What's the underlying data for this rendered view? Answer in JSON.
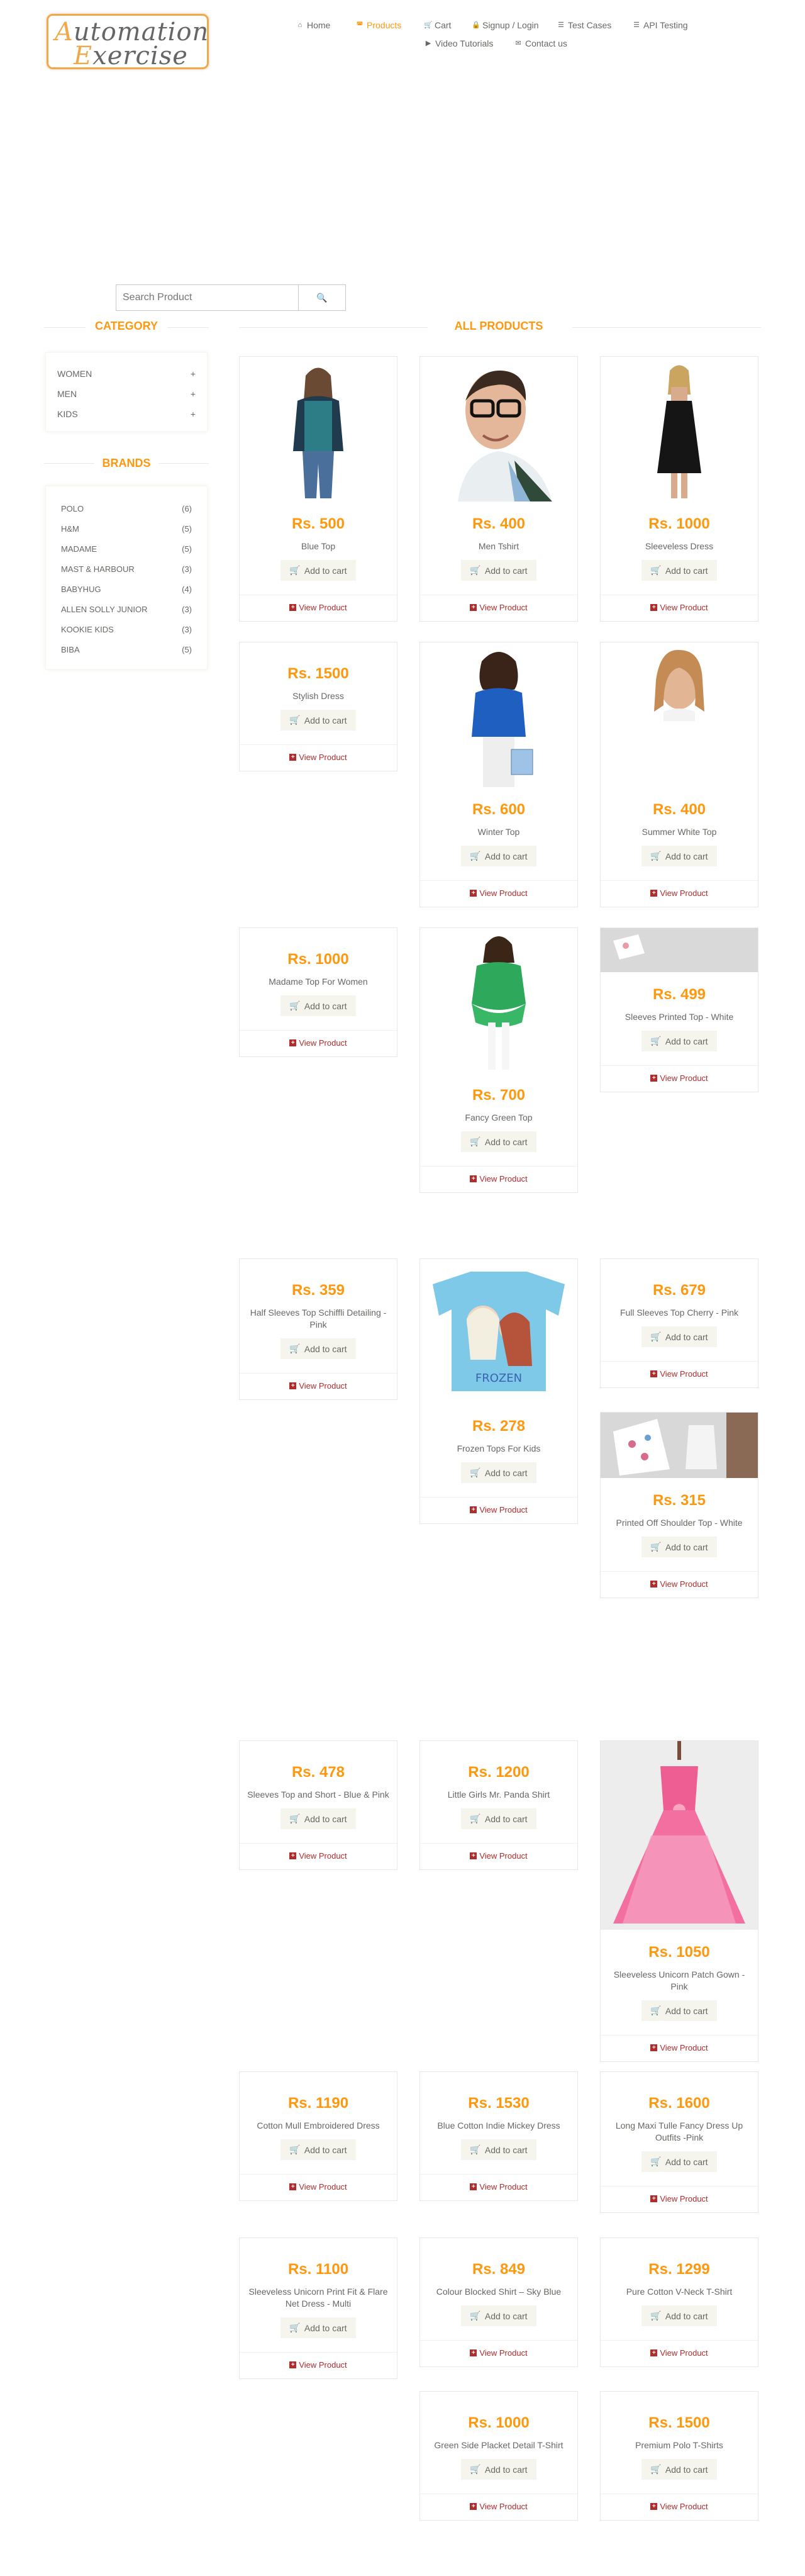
{
  "header": {
    "logo": {
      "line1": "Automation",
      "line2": "Exercise"
    },
    "nav": [
      {
        "label": "Home",
        "icon": "home-icon"
      },
      {
        "label": "Products",
        "icon": "products-icon"
      },
      {
        "label": "Cart",
        "icon": "cart-icon"
      },
      {
        "label": "Signup / Login",
        "icon": "lock-icon"
      },
      {
        "label": "Test Cases",
        "icon": "list-icon"
      },
      {
        "label": "API Testing",
        "icon": "list-icon"
      },
      {
        "label": "Video Tutorials",
        "icon": "youtube-icon"
      },
      {
        "label": "Contact us",
        "icon": "envelope-icon"
      }
    ]
  },
  "search": {
    "placeholder": "Search Product",
    "button_icon": "search-icon"
  },
  "sidebar": {
    "category_title": "Category",
    "categories": [
      {
        "label": "WOMEN"
      },
      {
        "label": "MEN"
      },
      {
        "label": "KIDS"
      }
    ],
    "brands_title": "Brands",
    "brands": [
      {
        "label": "POLO",
        "count": "(6)"
      },
      {
        "label": "H&M",
        "count": "(5)"
      },
      {
        "label": "MADAME",
        "count": "(5)"
      },
      {
        "label": "MAST & HARBOUR",
        "count": "(3)"
      },
      {
        "label": "BABYHUG",
        "count": "(4)"
      },
      {
        "label": "ALLEN SOLLY JUNIOR",
        "count": "(3)"
      },
      {
        "label": "KOOKIE KIDS",
        "count": "(3)"
      },
      {
        "label": "BIBA",
        "count": "(5)"
      }
    ]
  },
  "main": {
    "title": "All Products",
    "add_to_cart": "Add to cart",
    "view_product": "View Product",
    "products": [
      {
        "price": "Rs. 500",
        "name": "Blue Top"
      },
      {
        "price": "Rs. 400",
        "name": "Men Tshirt"
      },
      {
        "price": "Rs. 1000",
        "name": "Sleeveless Dress"
      },
      {
        "price": "Rs. 1500",
        "name": "Stylish Dress"
      },
      {
        "price": "Rs. 600",
        "name": "Winter Top"
      },
      {
        "price": "Rs. 400",
        "name": "Summer White Top"
      },
      {
        "price": "Rs. 1000",
        "name": "Madame Top For Women"
      },
      {
        "price": "Rs. 700",
        "name": "Fancy Green Top"
      },
      {
        "price": "Rs. 499",
        "name": "Sleeves Printed Top - White"
      },
      {
        "price": "Rs. 359",
        "name": "Half Sleeves Top Schiffli Detailing - Pink"
      },
      {
        "price": "Rs. 278",
        "name": "Frozen Tops For Kids"
      },
      {
        "price": "Rs. 679",
        "name": "Full Sleeves Top Cherry - Pink"
      },
      {
        "price": "Rs. 315",
        "name": "Printed Off Shoulder Top - White"
      },
      {
        "price": "Rs. 478",
        "name": "Sleeves Top and Short - Blue & Pink"
      },
      {
        "price": "Rs. 1200",
        "name": "Little Girls Mr. Panda Shirt"
      },
      {
        "price": "Rs. 1050",
        "name": "Sleeveless Unicorn Patch Gown - Pink"
      },
      {
        "price": "Rs. 1190",
        "name": "Cotton Mull Embroidered Dress"
      },
      {
        "price": "Rs. 1530",
        "name": "Blue Cotton Indie Mickey Dress"
      },
      {
        "price": "Rs. 1600",
        "name": "Long Maxi Tulle Fancy Dress Up Outfits -Pink"
      },
      {
        "price": "Rs. 1100",
        "name": "Sleeveless Unicorn Print Fit & Flare Net Dress - Multi"
      },
      {
        "price": "Rs. 849",
        "name": "Colour Blocked Shirt – Sky Blue"
      },
      {
        "price": "Rs. 1299",
        "name": "Pure Cotton V-Neck T-Shirt"
      },
      {
        "price": "Rs. 1000",
        "name": "Green Side Placket Detail T-Shirt"
      },
      {
        "price": "Rs. 1500",
        "name": "Premium Polo T-Shirts"
      }
    ]
  }
}
